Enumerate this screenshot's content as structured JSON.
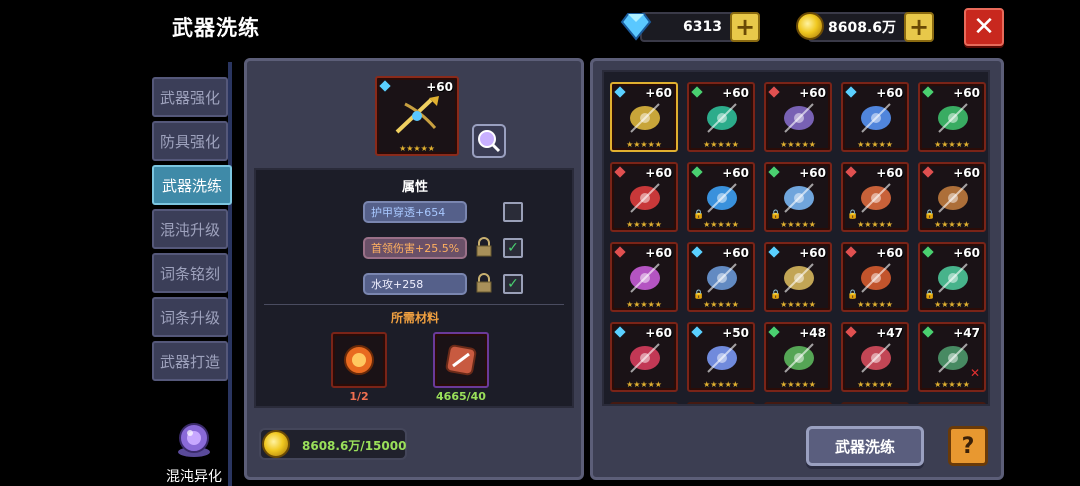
{
  "header": {
    "title": "武器洗练",
    "diamonds": "6313",
    "gold": "8608.6万",
    "plus": "+",
    "close": "✕"
  },
  "tabs": [
    {
      "label": "武器强化"
    },
    {
      "label": "防具强化"
    },
    {
      "label": "武器洗练"
    },
    {
      "label": "混沌升级"
    },
    {
      "label": "词条铭刻"
    },
    {
      "label": "词条升级"
    },
    {
      "label": "武器打造"
    }
  ],
  "chaos": {
    "label": "混沌异化"
  },
  "selected_weapon": {
    "level": "+60",
    "stars": "★★★★★"
  },
  "attributes": {
    "title": "属性",
    "items": [
      {
        "text": "护甲穿透+654",
        "locked": false,
        "checked": false
      },
      {
        "text": "首领伤害+25.5%",
        "locked": true,
        "checked": true
      },
      {
        "text": "水攻+258",
        "locked": true,
        "checked": true
      }
    ]
  },
  "materials": {
    "title": "所需材料",
    "items": [
      {
        "count": "1/2"
      },
      {
        "count": "4665/40"
      }
    ]
  },
  "gold_cost": "8608.6万/15000",
  "action_button": "武器洗练",
  "help": "?",
  "colors": {
    "accent": "#3f8aa8",
    "slot_border": "#7a2418",
    "select": "#e0b030",
    "green_text": "#9ae05a"
  },
  "inventory": [
    {
      "level": "+60",
      "stars": "★★★★★",
      "icon": "golden-bow-icon",
      "gem": "#5ad0ff",
      "selected": true,
      "lock": false
    },
    {
      "level": "+60",
      "stars": "★★★★★",
      "icon": "dark-axe-icon",
      "gem": "#4ad070",
      "lock": false
    },
    {
      "level": "+60",
      "stars": "★★★★★",
      "icon": "rune-book-icon",
      "gem": "#e05050",
      "lock": false
    },
    {
      "level": "+60",
      "stars": "★★★★★",
      "icon": "blue-staff-icon",
      "gem": "#5ad0ff",
      "lock": false
    },
    {
      "level": "+60",
      "stars": "★★★★★",
      "icon": "green-dragon-icon",
      "gem": "#4ad070",
      "lock": false
    },
    {
      "level": "+60",
      "stars": "★★★★★",
      "icon": "red-crystal-icon",
      "gem": "#e05050",
      "lock": false
    },
    {
      "level": "+60",
      "stars": "★★★★★",
      "icon": "blue-orb-icon",
      "gem": "#4ad070",
      "lock": true
    },
    {
      "level": "+60",
      "stars": "★★★★★",
      "icon": "ice-shield-icon",
      "gem": "#4ad070",
      "lock": true
    },
    {
      "level": "+60",
      "stars": "★★★★★",
      "icon": "flame-sword-icon",
      "gem": "#e05050",
      "lock": true
    },
    {
      "level": "+60",
      "stars": "★★★★★",
      "icon": "bronze-shield-icon",
      "gem": "#e05050",
      "lock": true
    },
    {
      "level": "+60",
      "stars": "★★★★★",
      "icon": "pink-scythe-icon",
      "gem": "#e05050",
      "lock": false
    },
    {
      "level": "+60",
      "stars": "★★★★★",
      "icon": "crystal-cannon-icon",
      "gem": "#5ad0ff",
      "lock": true
    },
    {
      "level": "+60",
      "stars": "★★★★★",
      "icon": "gold-ring-icon",
      "gem": "#5ad0ff",
      "lock": true
    },
    {
      "level": "+60",
      "stars": "★★★★★",
      "icon": "fire-armor-icon",
      "gem": "#e05050",
      "lock": true
    },
    {
      "level": "+60",
      "stars": "★★★★★",
      "icon": "jade-blade-icon",
      "gem": "#4ad070",
      "lock": true
    },
    {
      "level": "+60",
      "stars": "★★★★★",
      "icon": "red-gauntlet-icon",
      "gem": "#5ad0ff",
      "lock": false
    },
    {
      "level": "+50",
      "stars": "★★★★★",
      "icon": "spear-icon",
      "gem": "#5ad0ff",
      "lock": false
    },
    {
      "level": "+48",
      "stars": "★★★★★",
      "icon": "green-rifle-icon",
      "gem": "#4ad070",
      "lock": false
    },
    {
      "level": "+47",
      "stars": "★★★★★",
      "icon": "red-lantern-icon",
      "gem": "#e05050",
      "lock": false
    },
    {
      "level": "+47",
      "stars": "★★★★★",
      "icon": "bazooka-icon",
      "gem": "#4ad070",
      "lock": false,
      "cross": true
    }
  ]
}
